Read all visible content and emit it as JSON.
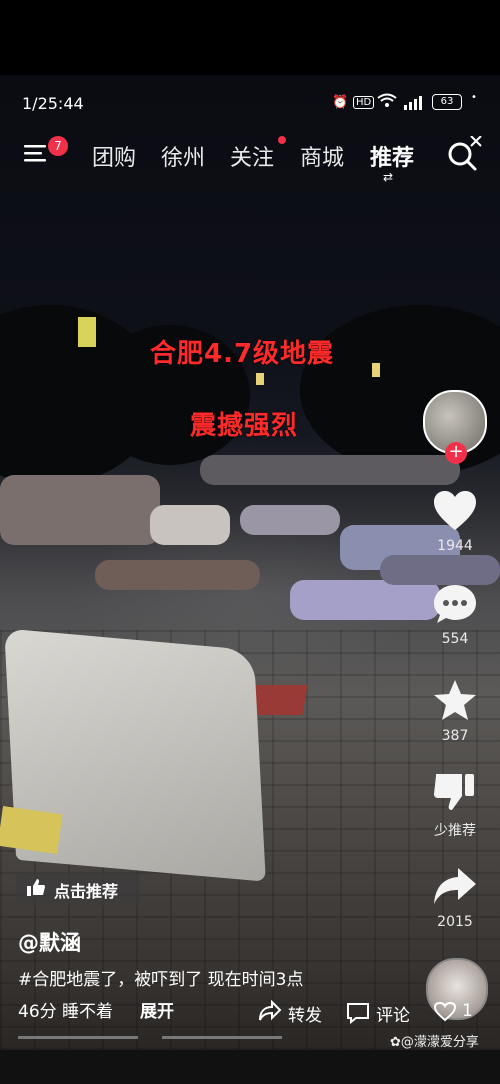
{
  "status_bar": {
    "time": "1/25:44",
    "battery": "63"
  },
  "top_nav": {
    "menu_badge": "7",
    "tabs": [
      {
        "label": "团购"
      },
      {
        "label": "徐州"
      },
      {
        "label": "关注"
      },
      {
        "label": "商城"
      },
      {
        "label": "推荐"
      }
    ]
  },
  "video": {
    "title_line1": "合肥4.7级地震",
    "title_line2": "震撼强烈"
  },
  "actions": {
    "likes": "1944",
    "comments": "554",
    "favorites": "387",
    "dislike_label": "少推荐",
    "shares": "2015"
  },
  "recommend_button": "点击推荐",
  "author": "@默涵",
  "caption": "#合肥地震了，被吓到了 现在时间3点",
  "caption_line2": "46分 睡不着",
  "expand": "展开",
  "bottom_actions": {
    "repost": "转发",
    "comment": "评论",
    "like_count": "1"
  },
  "watermark": "@濛濛爱分享"
}
